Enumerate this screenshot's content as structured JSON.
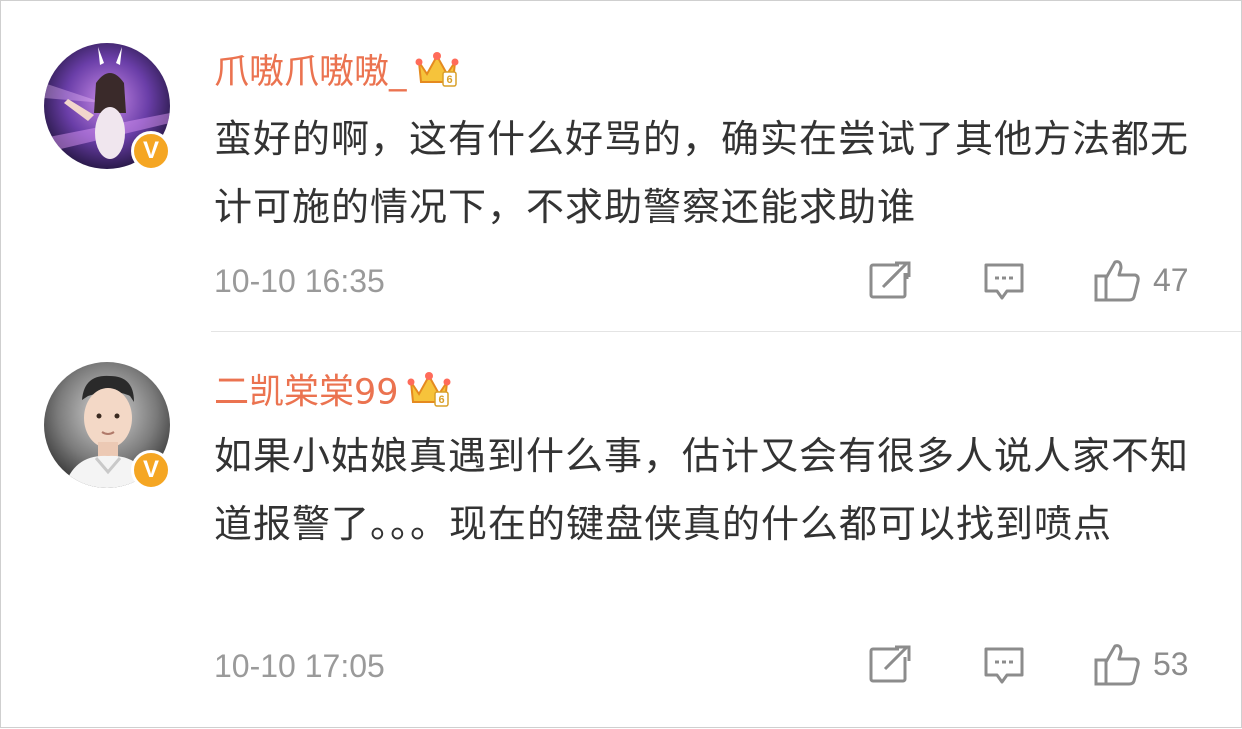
{
  "comments": [
    {
      "username": "爪嗷爪嗷嗷_",
      "verified_badge": "V",
      "crown_level": "6",
      "text": "蛮好的啊，这有什么好骂的，确实在尝试了其他方法都无计可施的情况下，不求助警察还能求助谁",
      "time": "10-10 16:35",
      "likes": "47",
      "icons": {
        "share": "share-icon",
        "reply": "comment-icon",
        "like": "thumbs-up-icon"
      }
    },
    {
      "username": "二凯棠棠99",
      "verified_badge": "V",
      "crown_level": "6",
      "text": "如果小姑娘真遇到什么事，估计又会有很多人说人家不知道报警了。。。现在的键盘侠真的什么都可以找到喷点",
      "time": "10-10 17:05",
      "likes": "53",
      "icons": {
        "share": "share-icon",
        "reply": "comment-icon",
        "like": "thumbs-up-icon"
      }
    }
  ],
  "colors": {
    "username": "#eb7350",
    "text": "#333333",
    "meta": "#9a9a9a",
    "badge": "#f5a623"
  }
}
